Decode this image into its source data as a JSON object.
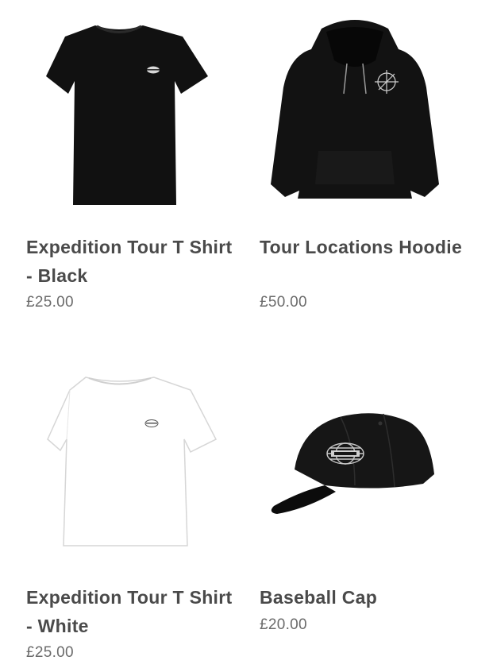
{
  "products": [
    {
      "name": "Expedition Tour T Shirt - Black",
      "price": "£25.00",
      "icon": "black-tshirt-image"
    },
    {
      "name": "Tour Locations Hoodie",
      "price": "£50.00",
      "icon": "black-hoodie-image"
    },
    {
      "name": "Expedition Tour T Shirt - White",
      "price": "£25.00",
      "icon": "white-tshirt-image"
    },
    {
      "name": "Baseball Cap",
      "price": "£20.00",
      "icon": "black-cap-image"
    }
  ],
  "colors": {
    "title": "#4a4a4a",
    "price": "#6b6b6b",
    "garment_black": "#111111",
    "garment_white": "#ffffff"
  }
}
